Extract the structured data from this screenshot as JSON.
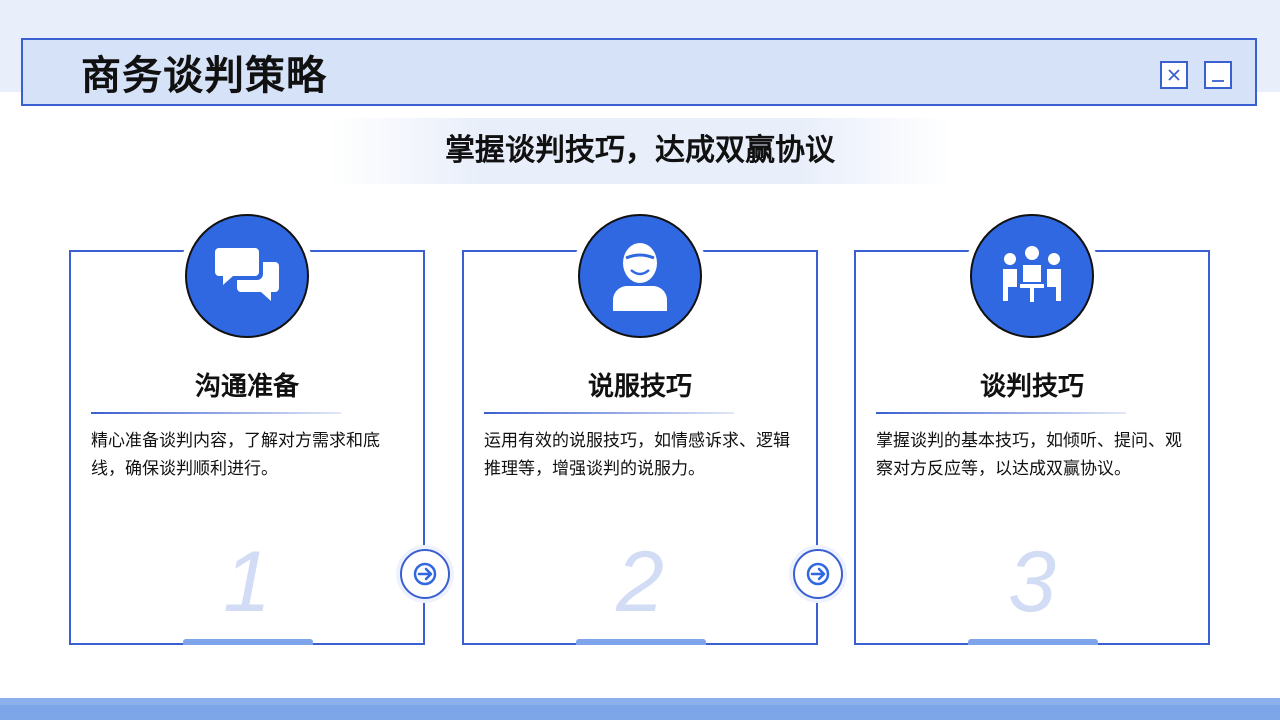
{
  "header": {
    "title": "商务谈判策略"
  },
  "window_controls": {
    "close_icon": "close-icon",
    "minimize_icon": "minimize-icon"
  },
  "subtitle": "掌握谈判技巧，达成双赢协议",
  "cards": [
    {
      "icon": "chat-bubbles-icon",
      "heading": "沟通准备",
      "description": "精心准备谈判内容，了解对方需求和底线，确保谈判顺利进行。",
      "number": "1"
    },
    {
      "icon": "person-icon",
      "heading": "说服技巧",
      "description": "运用有效的说服技巧，如情感诉求、逻辑推理等，增强谈判的说服力。",
      "number": "2"
    },
    {
      "icon": "meeting-people-icon",
      "heading": "谈判技巧",
      "description": "掌握谈判的基本技巧，如倾听、提问、观察对方反应等，以达成双赢协议。",
      "number": "3"
    }
  ],
  "arrows": [
    "arrow-right-icon",
    "arrow-right-icon"
  ],
  "colors": {
    "accent": "#2f68e0",
    "border": "#3a5fcf",
    "title_bar_bg": "#d6e2f7",
    "number_color": "#d2dcf4",
    "footer": "#8bb0ec"
  }
}
